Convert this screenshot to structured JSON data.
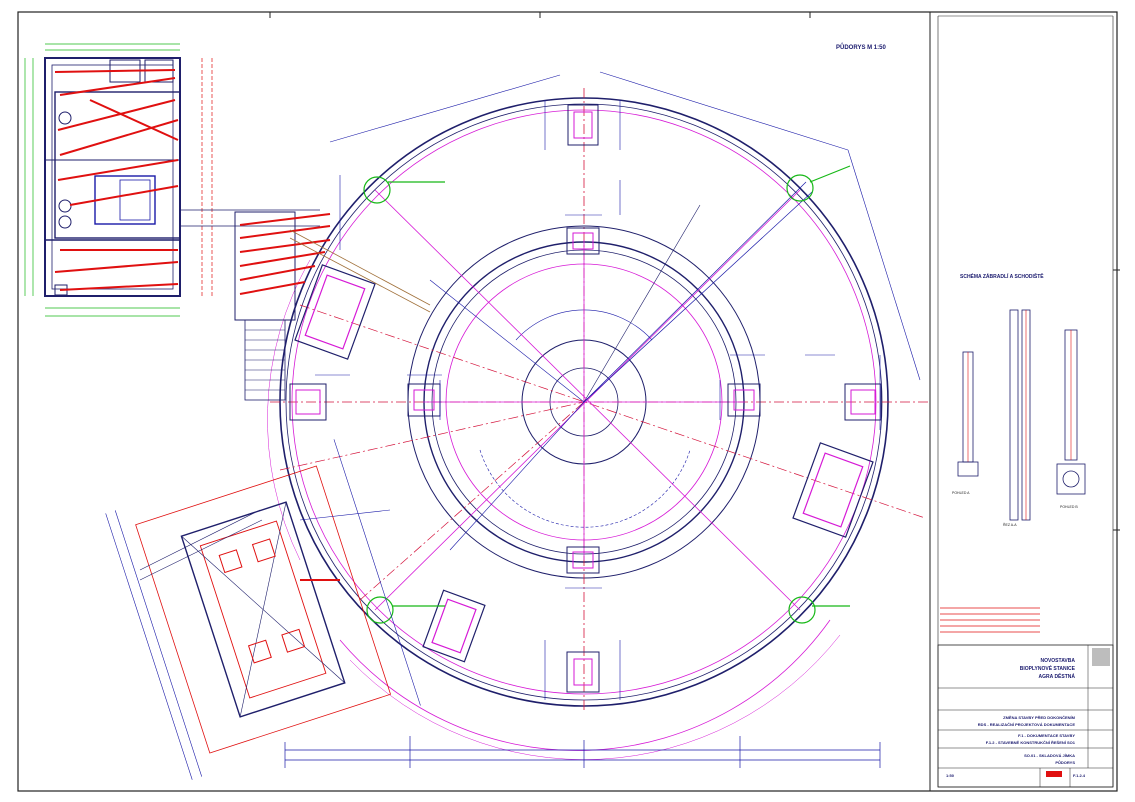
{
  "drawing": {
    "plan_title": "PŮDORYS M 1:50",
    "detail_title": "SCHÉMA ZÁBRADLÍ A SCHODIŠTĚ",
    "detail_labels": [
      "POHLED A",
      "ŘEZ A-A",
      "POHLED B"
    ]
  },
  "title_block": {
    "project_lines": [
      "NOVOSTAVBA",
      "BIOPLYNOVÉ STANICE",
      "AGRA DĚSTNÁ"
    ],
    "part_lines": [
      "ZMĚNA STAVBY PŘED DOKONČENÍM",
      "RDS - REALIZAČNÍ PROJEKTOVÁ DOKUMENTACE"
    ],
    "section_lines": [
      "F.1 - DOKUMENTACE STAVBY",
      "F.1.2 - STAVEBNĚ KONSTRUKČNÍ ŘEŠENÍ SO1"
    ],
    "object_lines": [
      "SO.01 - SKLADOVÁ JÍMKA",
      "PŮDORYS"
    ],
    "scale": "1:50",
    "sheet_no": "F.1.2.4"
  },
  "colors": {
    "frame": "#222222",
    "structure": "#1f1f6b",
    "dimension": "#1a1aa8",
    "axis": "#d4143c",
    "rebar": "#e01010",
    "magenta": "#d61ad6",
    "green": "#16b816",
    "brown": "#a0703a"
  }
}
